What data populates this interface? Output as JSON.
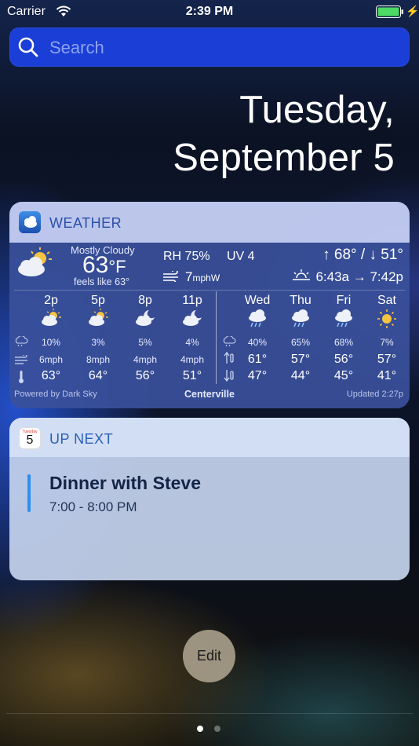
{
  "status_bar": {
    "carrier": "Carrier",
    "time": "2:39 PM"
  },
  "search": {
    "placeholder": "Search"
  },
  "date": {
    "line1": "Tuesday,",
    "line2": "September 5"
  },
  "weather": {
    "title": "WEATHER",
    "condition": "Mostly Cloudy",
    "temp": "63",
    "temp_unit": "°F",
    "feels_like_label": "feels like",
    "feels_like": "63°",
    "rh": "RH 75%",
    "uv": "UV 4",
    "wind": "7",
    "wind_unit": "mphW",
    "high_low": "↑ 68° / ↓ 51°",
    "sun_times": "6:43a → 7:42p",
    "hourly": [
      {
        "time": "2p",
        "precip": "10%",
        "wind": "6mph",
        "temp": "63°"
      },
      {
        "time": "5p",
        "precip": "3%",
        "wind": "8mph",
        "temp": "64°"
      },
      {
        "time": "8p",
        "precip": "5%",
        "wind": "4mph",
        "temp": "56°"
      },
      {
        "time": "11p",
        "precip": "4%",
        "wind": "4mph",
        "temp": "51°"
      }
    ],
    "daily": [
      {
        "day": "Wed",
        "precip": "40%",
        "high": "61°",
        "low": "47°"
      },
      {
        "day": "Thu",
        "precip": "65%",
        "high": "57°",
        "low": "44°"
      },
      {
        "day": "Fri",
        "precip": "68%",
        "high": "56°",
        "low": "45°"
      },
      {
        "day": "Sat",
        "precip": "7%",
        "high": "57°",
        "low": "41°"
      }
    ],
    "powered_by": "Powered by Dark Sky",
    "location": "Centerville",
    "updated": "Updated 2:27p"
  },
  "up_next": {
    "title": "UP NEXT",
    "calendar_icon_day": "Tuesday",
    "calendar_icon_date": "5",
    "event_title": "Dinner with Steve",
    "event_time": "7:00 - 8:00 PM"
  },
  "edit_label": "Edit",
  "colors": {
    "search_bg": "#1b3ed6",
    "widget_blue": "#3a509b",
    "event_accent": "#2c8ff0"
  }
}
